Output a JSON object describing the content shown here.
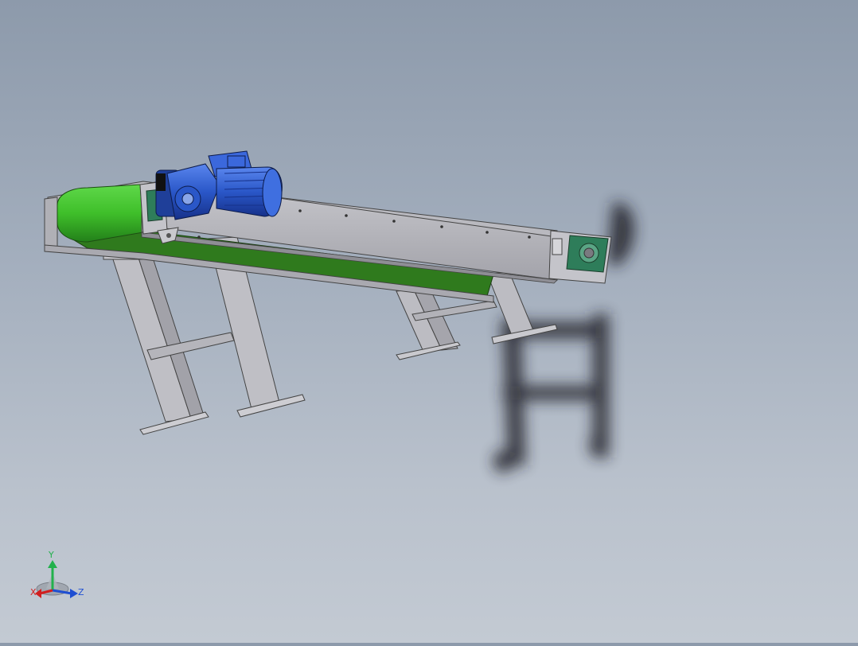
{
  "viewport": {
    "background_top": "#8d9aab",
    "background_bottom": "#c3cad3"
  },
  "model": {
    "belt_color": "#2f8a1c",
    "roller_color": "#3fbf2a",
    "frame_color": "#b7b7bd",
    "motor_color": "#2a57c8",
    "bearing_color": "#2e7d5a"
  },
  "triad": {
    "x_label": "X",
    "y_label": "Y",
    "z_label": "Z",
    "x_color": "#d21f1f",
    "y_color": "#22b14c",
    "z_color": "#1f4fd2"
  }
}
